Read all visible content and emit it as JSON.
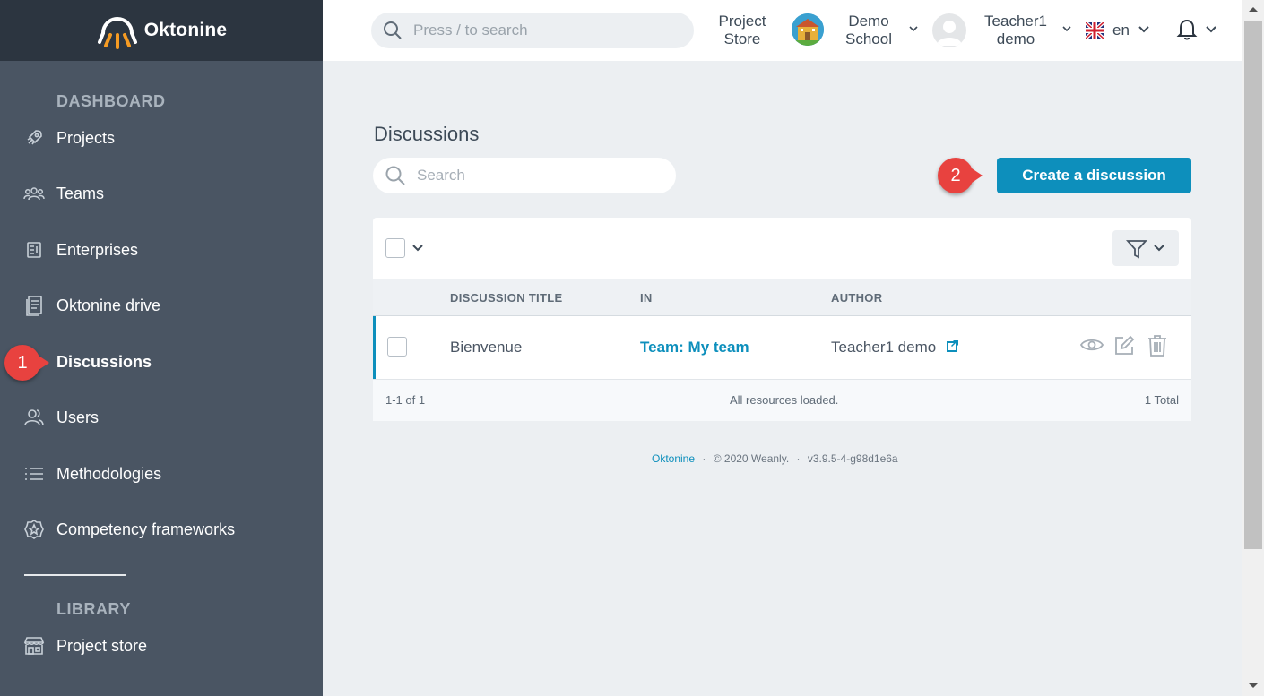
{
  "app": {
    "name": "Oktonine"
  },
  "sidebar": {
    "sections": [
      {
        "title": "DASHBOARD"
      },
      {
        "title": "LIBRARY"
      }
    ],
    "items": [
      {
        "label": "Projects",
        "icon": "rocket-icon"
      },
      {
        "label": "Teams",
        "icon": "people-icon"
      },
      {
        "label": "Enterprises",
        "icon": "building-icon"
      },
      {
        "label": "Oktonine drive",
        "icon": "document-icon"
      },
      {
        "label": "Discussions",
        "icon": "chat-icon",
        "active": true
      },
      {
        "label": "Users",
        "icon": "users-icon"
      },
      {
        "label": "Methodologies",
        "icon": "list-icon"
      },
      {
        "label": "Competency frameworks",
        "icon": "badge-icon"
      },
      {
        "label": "Project store",
        "icon": "store-icon"
      }
    ]
  },
  "markers": [
    "1",
    "2"
  ],
  "topbar": {
    "search_placeholder": "Press / to search",
    "project_store_line1": "Project",
    "project_store_line2": "Store",
    "school_line1": "Demo",
    "school_line2": "School",
    "user_line1": "Teacher1",
    "user_line2": "demo",
    "language": "en"
  },
  "main": {
    "title": "Discussions",
    "search_placeholder": "Search",
    "create_button": "Create a discussion",
    "table": {
      "columns": [
        "DISCUSSION TITLE",
        "IN",
        "AUTHOR"
      ],
      "rows": [
        {
          "title": "Bienvenue",
          "in": "Team: My team",
          "author": "Teacher1 demo"
        }
      ],
      "footer": {
        "range": "1-1 of 1",
        "status": "All resources loaded.",
        "total": "1 Total"
      }
    }
  },
  "footer": {
    "brand": "Oktonine",
    "sep1": "·",
    "copyright": "© 2020 Weanly.",
    "sep2": "·",
    "version": "v3.9.5-4-g98d1e6a"
  },
  "colors": {
    "sidebar_bg": "#4a5563",
    "sidebar_header_bg": "#2c3540",
    "accent": "#0d8fbc",
    "marker": "#e8423f",
    "logo_orange": "#f59b23"
  }
}
